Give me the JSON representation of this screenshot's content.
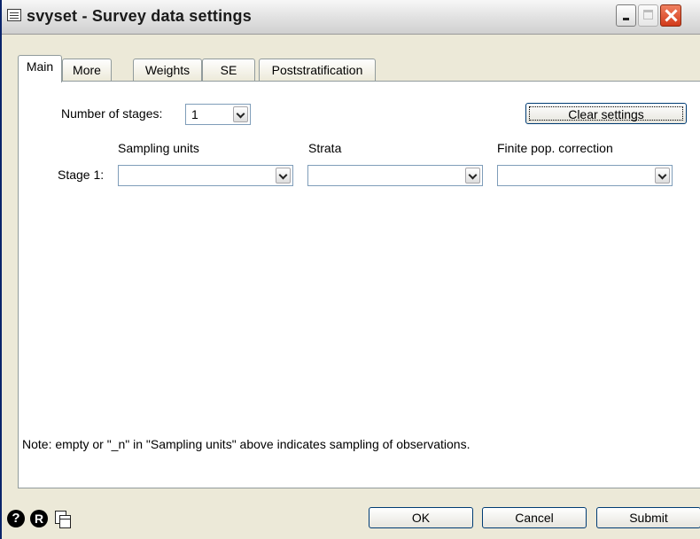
{
  "window": {
    "title": "svyset - Survey data settings"
  },
  "tabs": [
    {
      "label": "Main",
      "active": true
    },
    {
      "label": "More"
    },
    {
      "label": "Weights"
    },
    {
      "label": "SE"
    },
    {
      "label": "Poststratification"
    }
  ],
  "main": {
    "stages_label": "Number of stages:",
    "stages_value": "1",
    "clear_label": "Clear settings",
    "columns": {
      "sampling_units": "Sampling units",
      "strata": "Strata",
      "fpc": "Finite pop. correction"
    },
    "stage1_label": "Stage 1:",
    "note": "Note: empty or \"_n\" in \"Sampling units\" above indicates sampling of observations."
  },
  "footer": {
    "ok": "OK",
    "cancel": "Cancel",
    "submit": "Submit",
    "help_glyph": "?",
    "reset_glyph": "R"
  },
  "colors": {
    "accent": "#0a246a",
    "border": "#7f9db9",
    "close": "#d23a1a"
  }
}
